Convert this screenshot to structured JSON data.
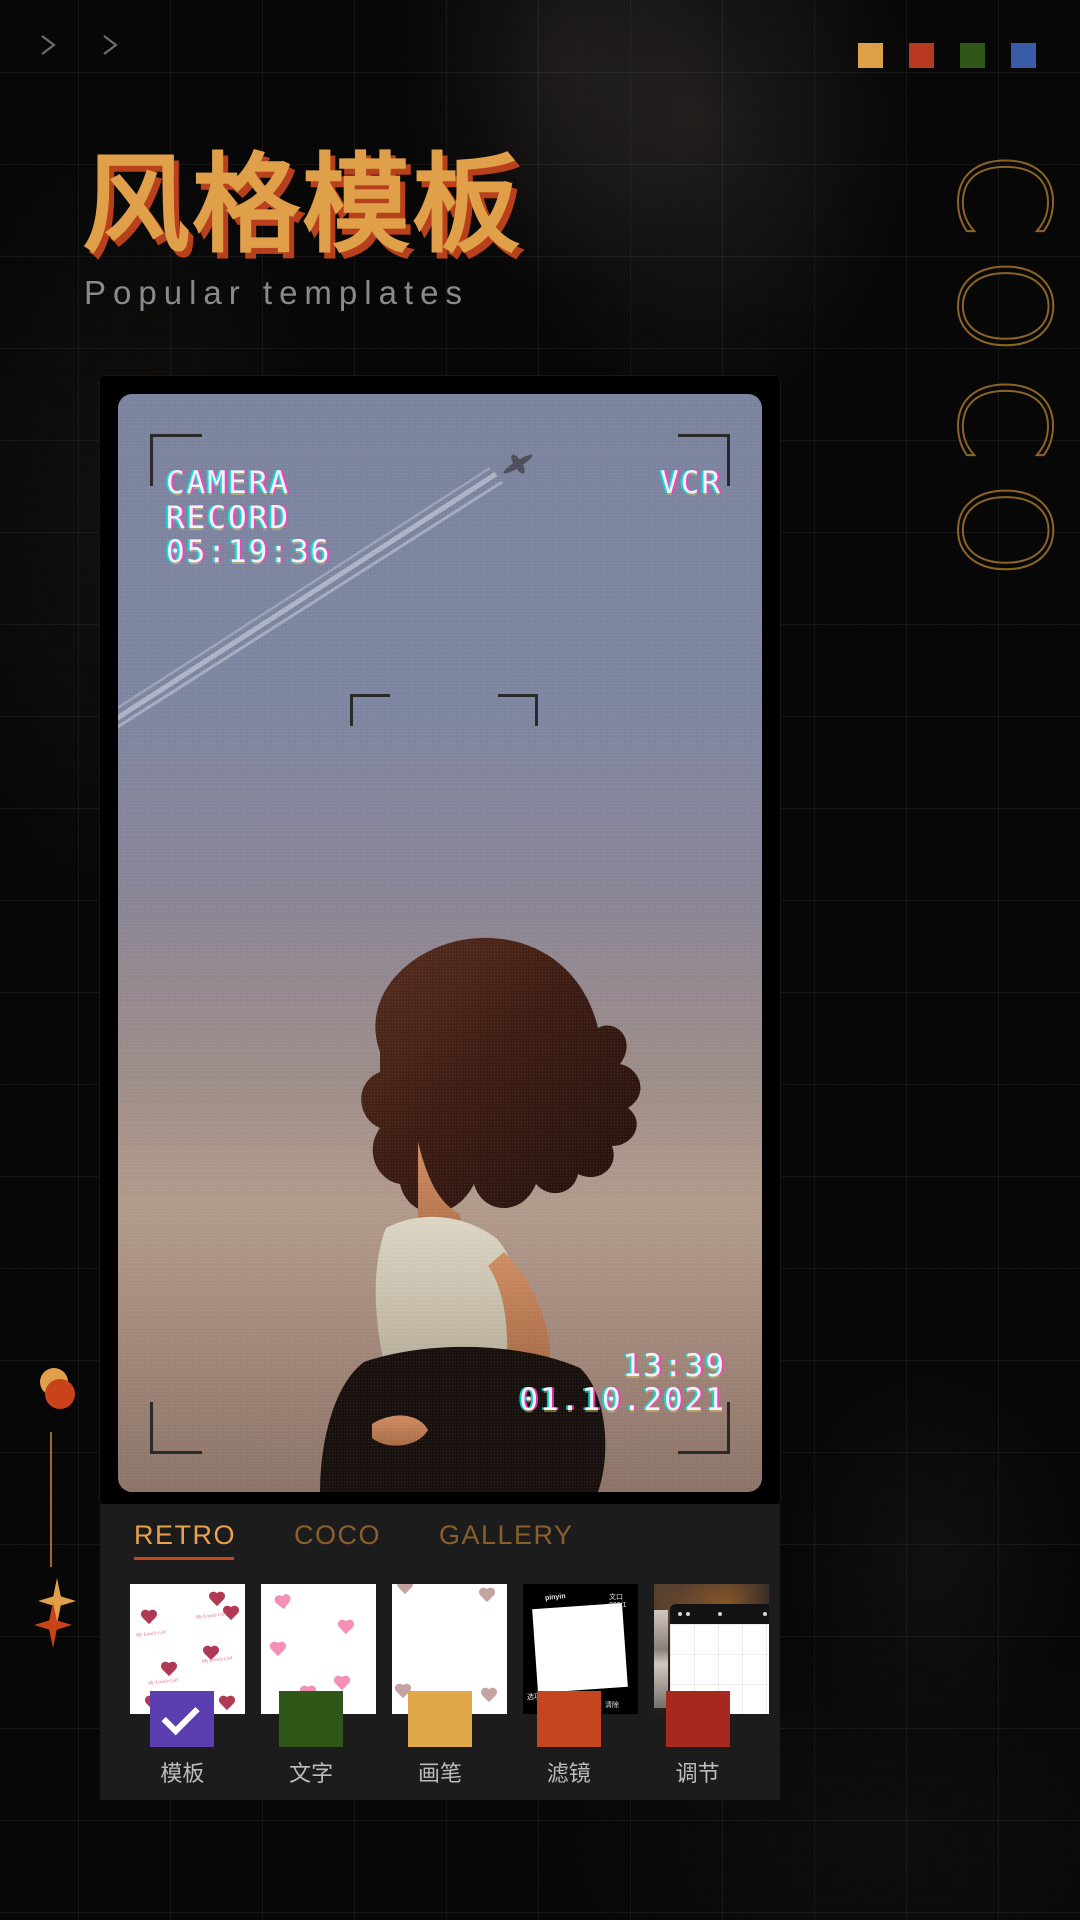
{
  "header": {
    "chevrons": [
      "chevron-right-icon",
      "chevron-right-icon"
    ],
    "swatches": [
      {
        "name": "swatch-amber",
        "color": "#DDA046"
      },
      {
        "name": "swatch-red",
        "color": "#B8391F"
      },
      {
        "name": "swatch-green",
        "color": "#2F5818"
      },
      {
        "name": "swatch-blue",
        "color": "#3A5BA8"
      }
    ],
    "title_zh": "风格模板",
    "title_en": "Popular templates",
    "title_color": "#E0A04A",
    "title_shadow_color": "#B8401C"
  },
  "decoration": {
    "ghost_word_letters": [
      "C",
      "O",
      "C",
      "O"
    ],
    "ghost_word_color": "#8a6426",
    "circle_top_color": "#E0A04A",
    "circle_bottom_color": "#C9421A",
    "line_color": "#9a6c2c",
    "star_top_color": "#E0A04A",
    "star_bottom_color": "#C9421A"
  },
  "preview": {
    "overlay": {
      "camera_label": "CAMERA",
      "record_label": "RECORD",
      "record_time": "05:19:36",
      "mode_label": "VCR",
      "clock": "13:39",
      "date": "01.10.2021"
    }
  },
  "panel": {
    "tabs": [
      {
        "label": "RETRO",
        "active": true
      },
      {
        "label": "COCO",
        "active": false
      },
      {
        "label": "GALLERY",
        "active": false
      }
    ],
    "active_tab_color": "#E8A24C",
    "inactive_tab_color": "#8A5F2A",
    "underline_color": "#C4451E",
    "thumbnails": [
      {
        "name": "thumb-hearts-dark",
        "caption": "My Lovely Girl"
      },
      {
        "name": "thumb-hearts-pink",
        "caption": ""
      },
      {
        "name": "thumb-hearts-pearl",
        "caption": ""
      },
      {
        "name": "thumb-pinyin-frame",
        "caption": "pinyin"
      },
      {
        "name": "thumb-phone-grid",
        "caption": ""
      }
    ],
    "thumb4_labels": {
      "brand": "pinyin",
      "top_right": "文口",
      "top_right_sub": "890/1",
      "bottom_left": "选项",
      "bottom_right": "清除"
    },
    "tools": [
      {
        "label": "模板",
        "color": "#5B3FB0",
        "selected": true
      },
      {
        "label": "文字",
        "color": "#2F5818",
        "selected": false
      },
      {
        "label": "画笔",
        "color": "#E0A848",
        "selected": false
      },
      {
        "label": "滤镜",
        "color": "#C4451E",
        "selected": false
      },
      {
        "label": "调节",
        "color": "#A7291E",
        "selected": false
      }
    ]
  }
}
